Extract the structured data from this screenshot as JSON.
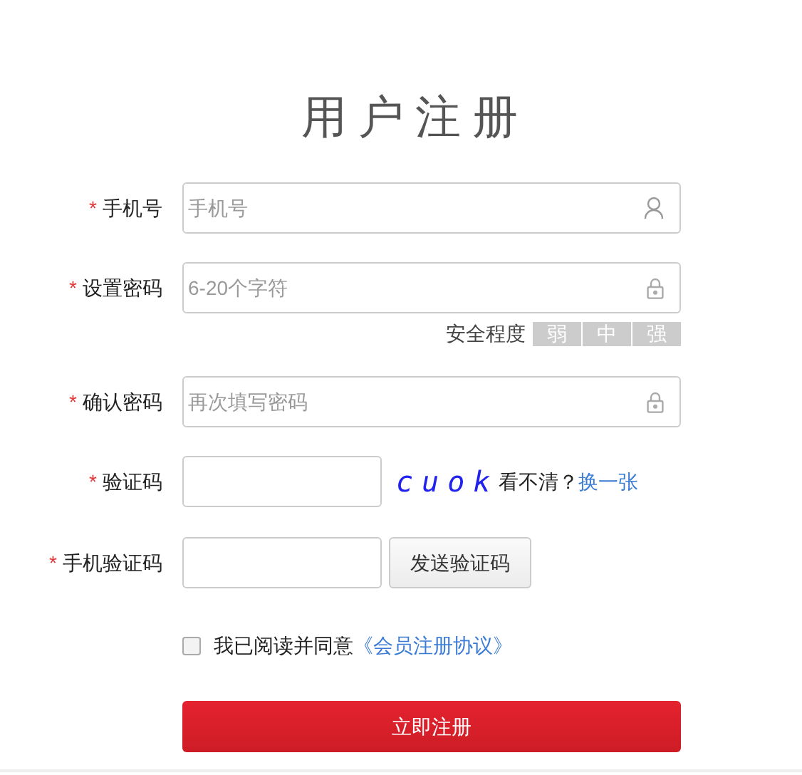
{
  "title": "用户注册",
  "fields": [
    {
      "kind": "phone-input",
      "label": "手机号",
      "required": "*",
      "placeholder": "手机号"
    },
    {
      "kind": "password-input",
      "label": "设置密码",
      "required": "*",
      "placeholder": "6-20个字符",
      "strength": {
        "label": "安全程度",
        "segments": [
          {
            "label": "弱",
            "on": false
          },
          {
            "label": "中",
            "on": false
          },
          {
            "label": "强",
            "on": false
          }
        ]
      }
    },
    {
      "kind": "password-input",
      "label": "确认密码",
      "required": "*",
      "placeholder": "再次填写密码"
    },
    {
      "kind": "captcha",
      "label": "验证码",
      "required": "*",
      "captcha": "cuok",
      "hint": "看不清？",
      "refresh": "换一张"
    },
    {
      "kind": "sms",
      "label": "手机验证码",
      "required": "*",
      "button": "发送验证码"
    }
  ],
  "agreement": {
    "checked": false,
    "text": "我已阅读并同意",
    "link": "《会员注册协议》"
  },
  "submit": "立即注册"
}
